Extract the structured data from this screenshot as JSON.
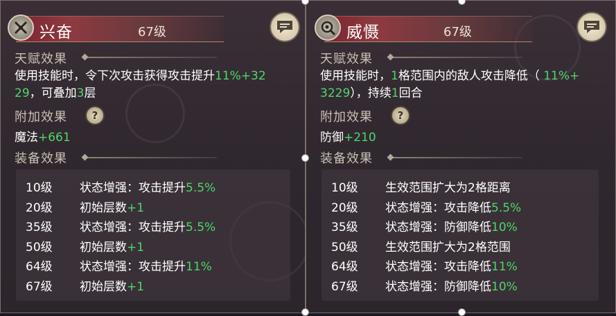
{
  "colors": {
    "highlight_green": "#4cd86a",
    "title_red": "#8e3a40",
    "text": "#ffffff",
    "section": "#c9bfb3"
  },
  "panels": [
    {
      "icon": "sword-cross-icon",
      "name": "兴奋",
      "level": "67级",
      "talent_title": "天赋效果",
      "talent_line1": [
        {
          "t": "使用技能时，令下次攻击获得攻击提升",
          "g": false
        },
        {
          "t": "11%+32",
          "g": true
        }
      ],
      "talent_line2": [
        {
          "t": "29",
          "g": true
        },
        {
          "t": "，可叠加",
          "g": false
        },
        {
          "t": "3",
          "g": true
        },
        {
          "t": "层",
          "g": false
        }
      ],
      "extra_title": "附加效果",
      "extra_stat": "魔法",
      "extra_value": "+661",
      "equip_title": "装备效果",
      "equip_rows": [
        {
          "level": "10级",
          "text": "状态增强：攻击提升",
          "value": "5.5%"
        },
        {
          "level": "20级",
          "text": "初始层数",
          "value": "+1"
        },
        {
          "level": "35级",
          "text": "状态增强：攻击提升",
          "value": "5.5%"
        },
        {
          "level": "50级",
          "text": "初始层数",
          "value": "+1"
        },
        {
          "level": "64级",
          "text": "状态增强：攻击提升",
          "value": "11%"
        },
        {
          "level": "67级",
          "text": "初始层数",
          "value": "+1"
        }
      ]
    },
    {
      "icon": "target-burst-icon",
      "name": "威慑",
      "level": "67级",
      "talent_title": "天赋效果",
      "talent_line1": [
        {
          "t": "使用技能时，",
          "g": false
        },
        {
          "t": "1",
          "g": true
        },
        {
          "t": "格范围内的敌人攻击降低（ ",
          "g": false
        },
        {
          "t": "11%+",
          "g": true
        }
      ],
      "talent_line2": [
        {
          "t": "3229",
          "g": true
        },
        {
          "t": "），持续",
          "g": false
        },
        {
          "t": "1",
          "g": true
        },
        {
          "t": "回合",
          "g": false
        }
      ],
      "extra_title": "附加效果",
      "extra_stat": "防御",
      "extra_value": "+210",
      "equip_title": "装备效果",
      "equip_rows": [
        {
          "level": "10级",
          "text": "生效范围扩大为2格距离",
          "value": ""
        },
        {
          "level": "20级",
          "text": "状态增强：攻击降低",
          "value": "5.5%"
        },
        {
          "level": "35级",
          "text": "状态增强：防御降低",
          "value": "10%"
        },
        {
          "level": "50级",
          "text": "生效范围扩大为2格范围",
          "value": ""
        },
        {
          "level": "64级",
          "text": "状态增强：攻击降低",
          "value": "11%"
        },
        {
          "level": "67级",
          "text": "状态增强：防御降低",
          "value": "10%"
        }
      ]
    }
  ]
}
